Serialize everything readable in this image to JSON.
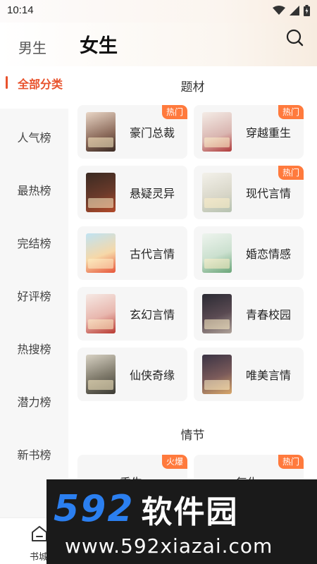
{
  "status": {
    "time": "10:14"
  },
  "header": {
    "tab_male": "男生",
    "tab_female": "女生"
  },
  "sidebar": {
    "items": [
      {
        "label": "全部分类",
        "active": true
      },
      {
        "label": "人气榜"
      },
      {
        "label": "最热榜"
      },
      {
        "label": "完结榜"
      },
      {
        "label": "好评榜"
      },
      {
        "label": "热搜榜"
      },
      {
        "label": "潜力榜"
      },
      {
        "label": "新书榜"
      }
    ]
  },
  "sections": {
    "theme_title": "题材",
    "plot_title": "情节"
  },
  "theme_cards": [
    {
      "name": "豪门总裁",
      "badge": "热门"
    },
    {
      "name": "穿越重生",
      "badge": "热门"
    },
    {
      "name": "悬疑灵异",
      "badge": ""
    },
    {
      "name": "现代言情",
      "badge": "热门"
    },
    {
      "name": "古代言情",
      "badge": ""
    },
    {
      "name": "婚恋情感",
      "badge": ""
    },
    {
      "name": "玄幻言情",
      "badge": ""
    },
    {
      "name": "青春校园",
      "badge": ""
    },
    {
      "name": "仙侠奇缘",
      "badge": ""
    },
    {
      "name": "唯美言情",
      "badge": ""
    }
  ],
  "plot_cards": [
    {
      "name": "重生",
      "badge": "火爆"
    },
    {
      "name": "复仇",
      "badge": "热门"
    }
  ],
  "bottom_nav": {
    "home_label": "书城"
  },
  "watermark": {
    "number": "592",
    "brand": "软件园",
    "url": "www.592xiazai.com"
  },
  "colors": {
    "accent": "#e8522c",
    "badge": "#ff7a3d",
    "watermark_blue": "#2b7ff0"
  }
}
